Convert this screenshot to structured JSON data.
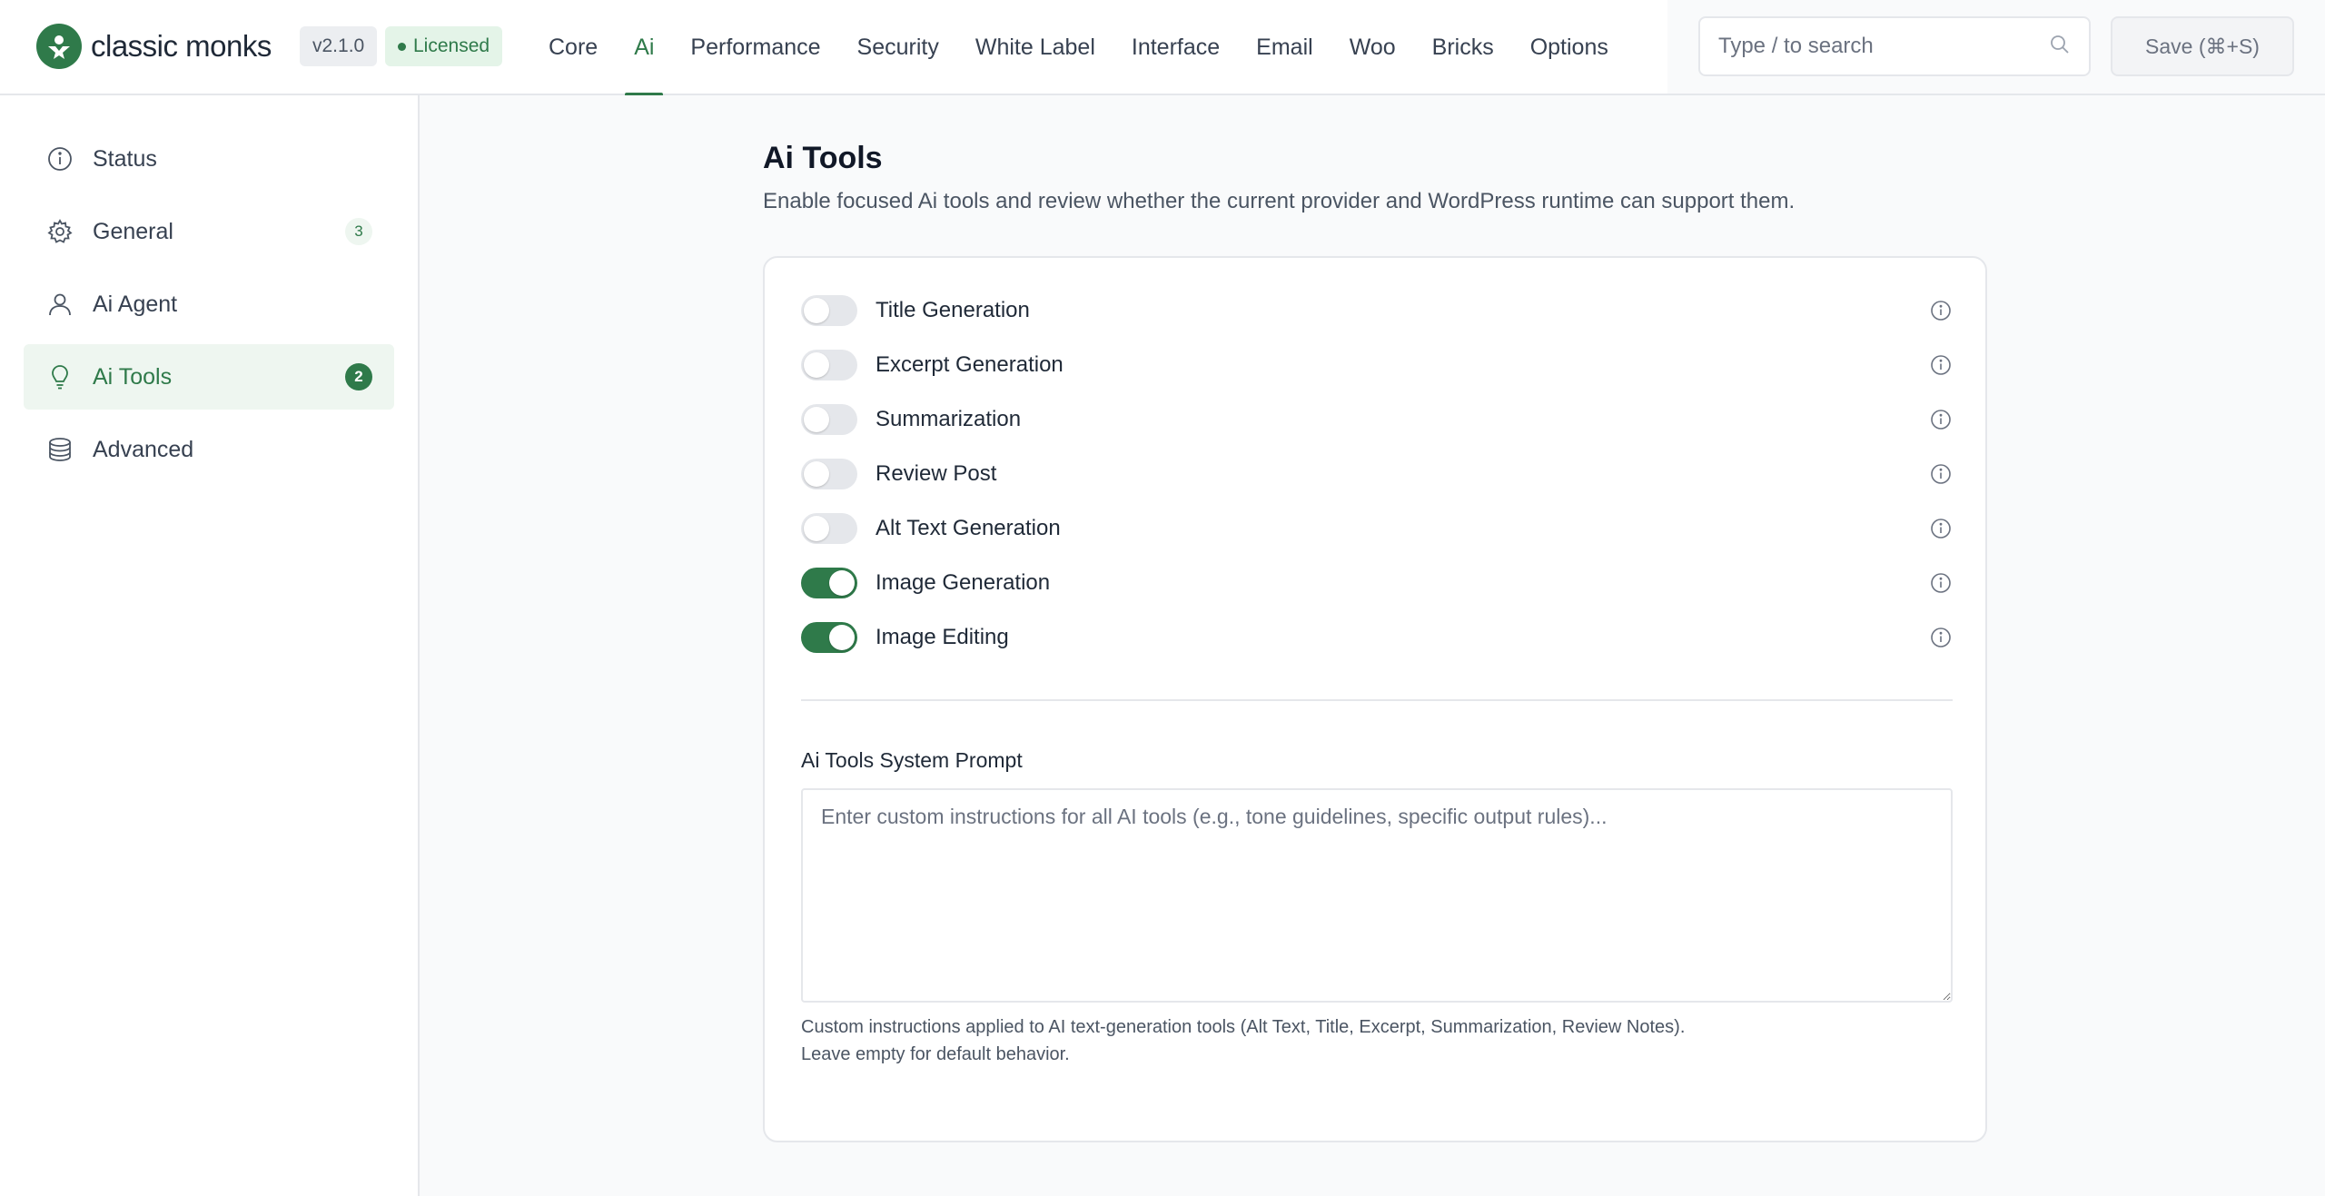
{
  "brand": {
    "name": "classic monks",
    "version": "v2.1.0",
    "license": "Licensed"
  },
  "nav": {
    "items": [
      {
        "label": "Core"
      },
      {
        "label": "Ai"
      },
      {
        "label": "Performance"
      },
      {
        "label": "Security"
      },
      {
        "label": "White Label"
      },
      {
        "label": "Interface"
      },
      {
        "label": "Email"
      },
      {
        "label": "Woo"
      },
      {
        "label": "Bricks"
      },
      {
        "label": "Options"
      }
    ],
    "active": "Ai"
  },
  "search": {
    "placeholder": "Type / to search"
  },
  "toolbar": {
    "save_label": "Save (⌘+S)"
  },
  "sidebar": {
    "items": [
      {
        "label": "Status",
        "icon": "info-icon"
      },
      {
        "label": "General",
        "icon": "gear-icon",
        "badge": "3"
      },
      {
        "label": "Ai Agent",
        "icon": "user-icon"
      },
      {
        "label": "Ai Tools",
        "icon": "lightbulb-icon",
        "badge": "2",
        "active": true
      },
      {
        "label": "Advanced",
        "icon": "database-icon"
      }
    ]
  },
  "main": {
    "title": "Ai Tools",
    "description": "Enable focused Ai tools and review whether the current provider and WordPress runtime can support them.",
    "tools": [
      {
        "label": "Title Generation",
        "enabled": false
      },
      {
        "label": "Excerpt Generation",
        "enabled": false
      },
      {
        "label": "Summarization",
        "enabled": false
      },
      {
        "label": "Review Post",
        "enabled": false
      },
      {
        "label": "Alt Text Generation",
        "enabled": false
      },
      {
        "label": "Image Generation",
        "enabled": true
      },
      {
        "label": "Image Editing",
        "enabled": true
      }
    ],
    "prompt": {
      "label": "Ai Tools System Prompt",
      "placeholder": "Enter custom instructions for all AI tools (e.g., tone guidelines, specific output rules)...",
      "value": "",
      "help_line1": "Custom instructions applied to AI text-generation tools (Alt Text, Title, Excerpt, Summarization, Review Notes).",
      "help_line2": "Leave empty for default behavior."
    }
  },
  "colors": {
    "accent": "#2f7a4a",
    "border": "#e5e7eb",
    "toggle_off": "#e5e7eb"
  }
}
